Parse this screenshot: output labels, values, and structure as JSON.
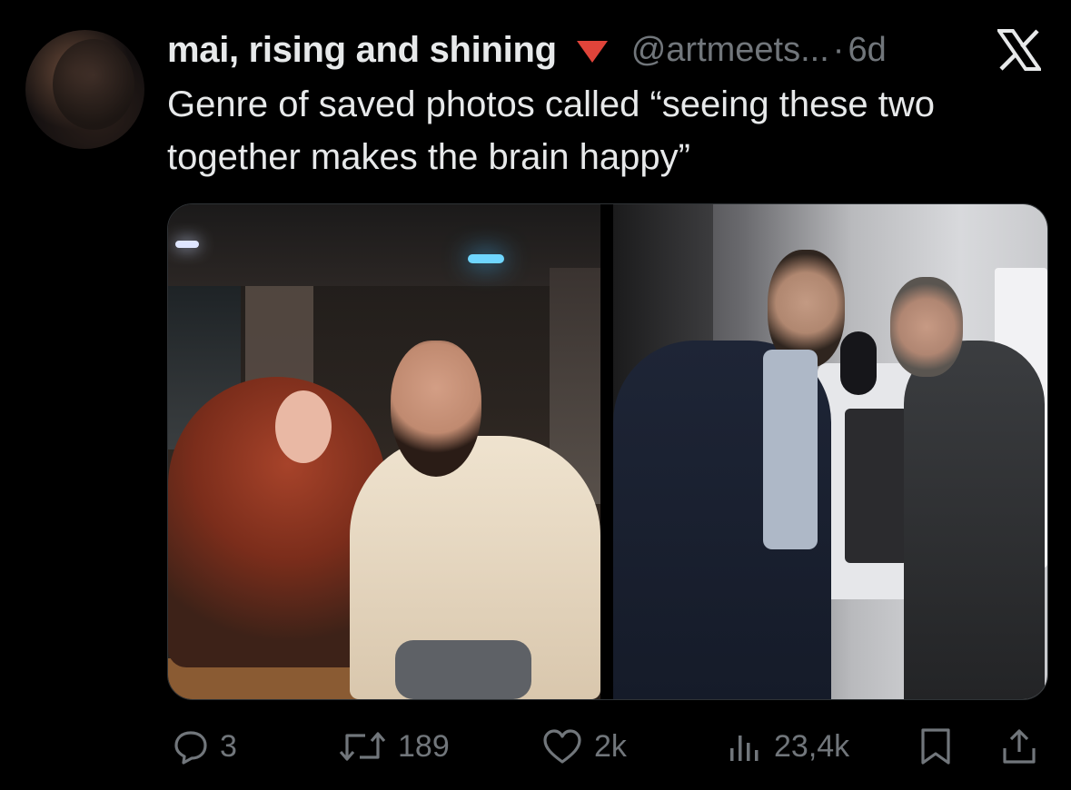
{
  "tweet": {
    "display_name": "mai, rising and shining",
    "badge_icon": "red-triangle-down-emoji",
    "handle": "@artmeets...",
    "separator": "·",
    "time": "6d",
    "text": "Genre of saved photos called “seeing these two\ntogether makes the brain happy”"
  },
  "platform_icon": "x-logo-icon",
  "actions": {
    "replies": "3",
    "reposts": "189",
    "likes": "2k",
    "views": "23,4k"
  },
  "colors": {
    "background": "#000000",
    "primary_text": "#e7e9ea",
    "secondary_text": "#71767b",
    "badge": "#e0443a"
  }
}
